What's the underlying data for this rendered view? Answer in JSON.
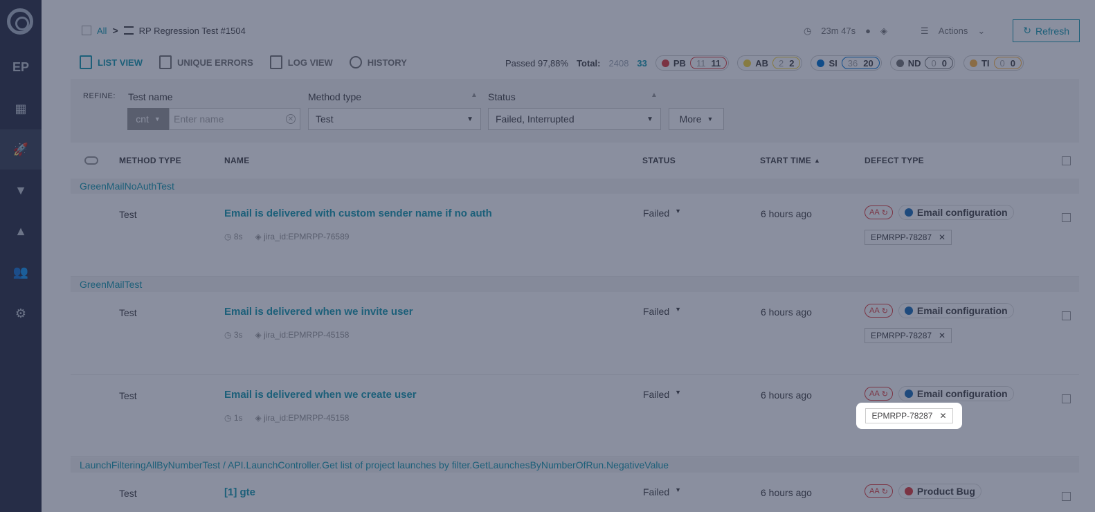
{
  "sidebar": {
    "items": [
      {
        "name": "EP",
        "label": "EP"
      },
      {
        "name": "dashboards",
        "label": "▦"
      },
      {
        "name": "launches",
        "label": "🚀"
      },
      {
        "name": "filters",
        "label": "▼"
      },
      {
        "name": "debug",
        "label": "▲"
      },
      {
        "name": "members",
        "label": "👥"
      },
      {
        "name": "settings",
        "label": "⚙"
      }
    ]
  },
  "breadcrumb": {
    "all": "All",
    "separator": ">",
    "launch": "RP Regression Test #1504"
  },
  "header": {
    "duration": "23m 47s",
    "actions": "Actions",
    "refresh": "Refresh"
  },
  "tabs": [
    {
      "label": "LIST VIEW"
    },
    {
      "label": "UNIQUE ERRORS"
    },
    {
      "label": "LOG VIEW"
    },
    {
      "label": "HISTORY"
    }
  ],
  "stats": {
    "passed": "Passed 97,88%",
    "total_label": "Total:",
    "total_value": "2408",
    "total_filtered": "33",
    "defects": [
      {
        "code": "PB",
        "total": "11",
        "count": "11",
        "color": "#e04040"
      },
      {
        "code": "AB",
        "total": "2",
        "count": "2",
        "color": "#f7d63e"
      },
      {
        "code": "SI",
        "total": "36",
        "count": "20",
        "color": "#0274d1"
      },
      {
        "code": "ND",
        "total": "0",
        "count": "0",
        "color": "#777777"
      },
      {
        "code": "TI",
        "total": "0",
        "count": "0",
        "color": "#ffb743"
      }
    ]
  },
  "refine": {
    "label": "REFINE:",
    "test_name_label": "Test name",
    "cnt": "cnt",
    "name_placeholder": "Enter name",
    "method_type_label": "Method type",
    "method_type_value": "Test",
    "status_label": "Status",
    "status_value": "Failed, Interrupted",
    "more": "More"
  },
  "table": {
    "headers": {
      "method_type": "METHOD TYPE",
      "name": "NAME",
      "status": "STATUS",
      "start_time": "START TIME",
      "defect_type": "DEFECT TYPE"
    },
    "groups": [
      {
        "label": "GreenMailNoAuthTest"
      },
      {
        "label": "GreenMailTest"
      },
      {
        "label": "LaunchFilteringAllByNumberTest   /   API.LaunchController.Get list of project launches by filter.GetLaunchesByNumberOfRun.NegativeValue"
      }
    ],
    "rows": [
      {
        "type": "Test",
        "name": "Email is delivered with custom sender name if no auth",
        "duration": "8s",
        "attr": "jira_id:EPMRPP-76589",
        "status": "Failed",
        "time": "6 hours ago",
        "aa": "AA",
        "defect": "Email configuration",
        "defect_color": "#1f6fb8",
        "issue": "EPMRPP-78287"
      },
      {
        "type": "Test",
        "name": "Email is delivered when we invite user",
        "duration": "3s",
        "attr": "jira_id:EPMRPP-45158",
        "status": "Failed",
        "time": "6 hours ago",
        "aa": "AA",
        "defect": "Email configuration",
        "defect_color": "#1f6fb8",
        "issue": "EPMRPP-78287"
      },
      {
        "type": "Test",
        "name": "Email is delivered when we create user",
        "duration": "1s",
        "attr": "jira_id:EPMRPP-45158",
        "status": "Failed",
        "time": "6 hours ago",
        "aa": "AA",
        "defect": "Email configuration",
        "defect_color": "#1f6fb8",
        "issue": "EPMRPP-78287"
      },
      {
        "type": "Test",
        "name": "[1] gte",
        "status": "Failed",
        "time": "6 hours ago",
        "aa": "AA",
        "defect": "Product Bug",
        "defect_color": "#e04040"
      }
    ]
  }
}
